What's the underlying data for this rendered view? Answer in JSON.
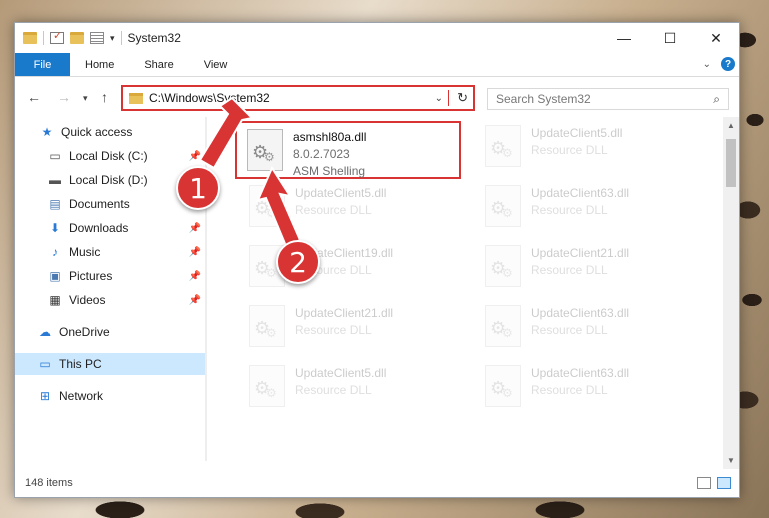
{
  "window": {
    "title": "System32",
    "controls": {
      "minimize": "—",
      "maximize": "☐",
      "close": "✕"
    }
  },
  "ribbon": {
    "file": "File",
    "tabs": [
      "Home",
      "Share",
      "View"
    ]
  },
  "address": {
    "path": "C:\\Windows\\System32"
  },
  "search": {
    "placeholder": "Search System32"
  },
  "sidebar": {
    "items": [
      {
        "label": "Quick access",
        "icon": "star-icon",
        "pinned": false
      },
      {
        "label": "Local Disk (C:)",
        "icon": "drive-icon",
        "pinned": true
      },
      {
        "label": "Local Disk (D:)",
        "icon": "drive-icon",
        "pinned": false
      },
      {
        "label": "Documents",
        "icon": "documents-icon",
        "pinned": true
      },
      {
        "label": "Downloads",
        "icon": "download-icon",
        "pinned": true
      },
      {
        "label": "Music",
        "icon": "music-icon",
        "pinned": true
      },
      {
        "label": "Pictures",
        "icon": "pictures-icon",
        "pinned": true
      },
      {
        "label": "Videos",
        "icon": "videos-icon",
        "pinned": true
      },
      {
        "label": "OneDrive",
        "icon": "cloud-icon",
        "pinned": false
      },
      {
        "label": "This PC",
        "icon": "computer-icon",
        "pinned": false
      },
      {
        "label": "Network",
        "icon": "network-icon",
        "pinned": false
      }
    ]
  },
  "files": {
    "highlighted": {
      "name": "asmshl80a.dll",
      "version": "8.0.2.7023",
      "description": "ASM Shelling"
    },
    "items": [
      {
        "name": "UpdateClient5.dll",
        "type": "Resource DLL"
      },
      {
        "name": "UpdateClient5.dll",
        "type": "Resource DLL"
      },
      {
        "name": "UpdateClient63.dll",
        "type": "Resource DLL"
      },
      {
        "name": "UpdateClient19.dll",
        "type": "Resource DLL"
      },
      {
        "name": "UpdateClient21.dll",
        "type": "Resource DLL"
      },
      {
        "name": "UpdateClient21.dll",
        "type": "Resource DLL"
      },
      {
        "name": "UpdateClient63.dll",
        "type": "Resource DLL"
      },
      {
        "name": "UpdateClient5.dll",
        "type": "Resource DLL"
      },
      {
        "name": "UpdateClient63.dll",
        "type": "Resource DLL"
      }
    ]
  },
  "status": {
    "count": "148 items"
  },
  "markers": {
    "one": "1",
    "two": "2"
  },
  "colors": {
    "accent": "#1979ca",
    "annotation": "#d93434",
    "selected": "#cce8ff"
  }
}
